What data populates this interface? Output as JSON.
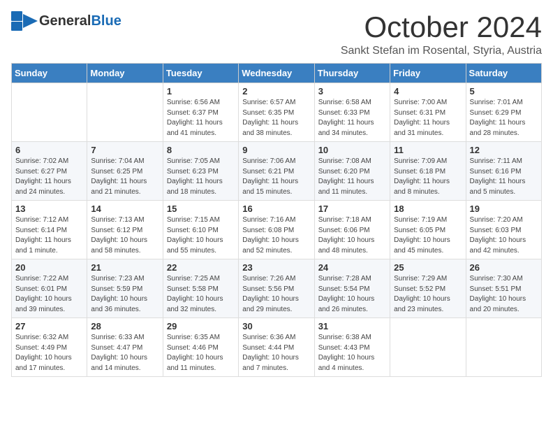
{
  "header": {
    "logo_general": "General",
    "logo_blue": "Blue",
    "month_title": "October 2024",
    "subtitle": "Sankt Stefan im Rosental, Styria, Austria"
  },
  "days_of_week": [
    "Sunday",
    "Monday",
    "Tuesday",
    "Wednesday",
    "Thursday",
    "Friday",
    "Saturday"
  ],
  "weeks": [
    [
      {
        "day": "",
        "info": ""
      },
      {
        "day": "",
        "info": ""
      },
      {
        "day": "1",
        "info": "Sunrise: 6:56 AM\nSunset: 6:37 PM\nDaylight: 11 hours and 41 minutes."
      },
      {
        "day": "2",
        "info": "Sunrise: 6:57 AM\nSunset: 6:35 PM\nDaylight: 11 hours and 38 minutes."
      },
      {
        "day": "3",
        "info": "Sunrise: 6:58 AM\nSunset: 6:33 PM\nDaylight: 11 hours and 34 minutes."
      },
      {
        "day": "4",
        "info": "Sunrise: 7:00 AM\nSunset: 6:31 PM\nDaylight: 11 hours and 31 minutes."
      },
      {
        "day": "5",
        "info": "Sunrise: 7:01 AM\nSunset: 6:29 PM\nDaylight: 11 hours and 28 minutes."
      }
    ],
    [
      {
        "day": "6",
        "info": "Sunrise: 7:02 AM\nSunset: 6:27 PM\nDaylight: 11 hours and 24 minutes."
      },
      {
        "day": "7",
        "info": "Sunrise: 7:04 AM\nSunset: 6:25 PM\nDaylight: 11 hours and 21 minutes."
      },
      {
        "day": "8",
        "info": "Sunrise: 7:05 AM\nSunset: 6:23 PM\nDaylight: 11 hours and 18 minutes."
      },
      {
        "day": "9",
        "info": "Sunrise: 7:06 AM\nSunset: 6:21 PM\nDaylight: 11 hours and 15 minutes."
      },
      {
        "day": "10",
        "info": "Sunrise: 7:08 AM\nSunset: 6:20 PM\nDaylight: 11 hours and 11 minutes."
      },
      {
        "day": "11",
        "info": "Sunrise: 7:09 AM\nSunset: 6:18 PM\nDaylight: 11 hours and 8 minutes."
      },
      {
        "day": "12",
        "info": "Sunrise: 7:11 AM\nSunset: 6:16 PM\nDaylight: 11 hours and 5 minutes."
      }
    ],
    [
      {
        "day": "13",
        "info": "Sunrise: 7:12 AM\nSunset: 6:14 PM\nDaylight: 11 hours and 1 minute."
      },
      {
        "day": "14",
        "info": "Sunrise: 7:13 AM\nSunset: 6:12 PM\nDaylight: 10 hours and 58 minutes."
      },
      {
        "day": "15",
        "info": "Sunrise: 7:15 AM\nSunset: 6:10 PM\nDaylight: 10 hours and 55 minutes."
      },
      {
        "day": "16",
        "info": "Sunrise: 7:16 AM\nSunset: 6:08 PM\nDaylight: 10 hours and 52 minutes."
      },
      {
        "day": "17",
        "info": "Sunrise: 7:18 AM\nSunset: 6:06 PM\nDaylight: 10 hours and 48 minutes."
      },
      {
        "day": "18",
        "info": "Sunrise: 7:19 AM\nSunset: 6:05 PM\nDaylight: 10 hours and 45 minutes."
      },
      {
        "day": "19",
        "info": "Sunrise: 7:20 AM\nSunset: 6:03 PM\nDaylight: 10 hours and 42 minutes."
      }
    ],
    [
      {
        "day": "20",
        "info": "Sunrise: 7:22 AM\nSunset: 6:01 PM\nDaylight: 10 hours and 39 minutes."
      },
      {
        "day": "21",
        "info": "Sunrise: 7:23 AM\nSunset: 5:59 PM\nDaylight: 10 hours and 36 minutes."
      },
      {
        "day": "22",
        "info": "Sunrise: 7:25 AM\nSunset: 5:58 PM\nDaylight: 10 hours and 32 minutes."
      },
      {
        "day": "23",
        "info": "Sunrise: 7:26 AM\nSunset: 5:56 PM\nDaylight: 10 hours and 29 minutes."
      },
      {
        "day": "24",
        "info": "Sunrise: 7:28 AM\nSunset: 5:54 PM\nDaylight: 10 hours and 26 minutes."
      },
      {
        "day": "25",
        "info": "Sunrise: 7:29 AM\nSunset: 5:52 PM\nDaylight: 10 hours and 23 minutes."
      },
      {
        "day": "26",
        "info": "Sunrise: 7:30 AM\nSunset: 5:51 PM\nDaylight: 10 hours and 20 minutes."
      }
    ],
    [
      {
        "day": "27",
        "info": "Sunrise: 6:32 AM\nSunset: 4:49 PM\nDaylight: 10 hours and 17 minutes."
      },
      {
        "day": "28",
        "info": "Sunrise: 6:33 AM\nSunset: 4:47 PM\nDaylight: 10 hours and 14 minutes."
      },
      {
        "day": "29",
        "info": "Sunrise: 6:35 AM\nSunset: 4:46 PM\nDaylight: 10 hours and 11 minutes."
      },
      {
        "day": "30",
        "info": "Sunrise: 6:36 AM\nSunset: 4:44 PM\nDaylight: 10 hours and 7 minutes."
      },
      {
        "day": "31",
        "info": "Sunrise: 6:38 AM\nSunset: 4:43 PM\nDaylight: 10 hours and 4 minutes."
      },
      {
        "day": "",
        "info": ""
      },
      {
        "day": "",
        "info": ""
      }
    ]
  ]
}
